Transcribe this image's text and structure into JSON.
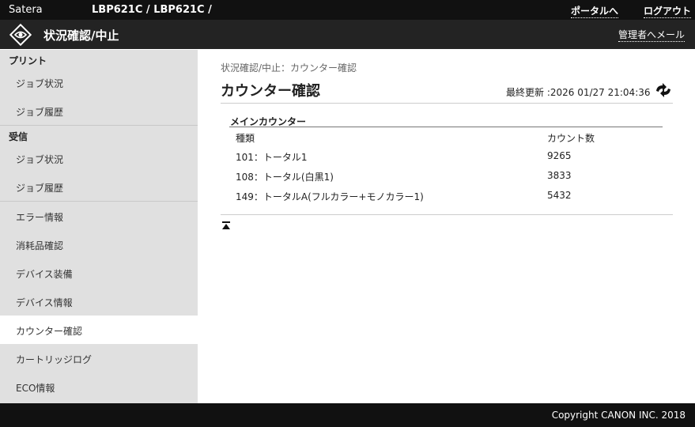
{
  "topbar": {
    "brand": "Satera",
    "model": "LBP621C / LBP621C /",
    "portal": "ポータルへ",
    "logout": "ログアウト"
  },
  "header": {
    "title": "状況確認/中止",
    "mail": "管理者へメール"
  },
  "sidebar": {
    "sections": [
      {
        "label": "プリント",
        "items": [
          "ジョブ状況",
          "ジョブ履歴"
        ]
      },
      {
        "label": "受信",
        "items": [
          "ジョブ状況",
          "ジョブ履歴"
        ]
      }
    ],
    "items": [
      "エラー情報",
      "消耗品確認",
      "デバイス装備",
      "デバイス情報",
      "カウンター確認",
      "カートリッジログ",
      "ECO情報"
    ],
    "selected": "カウンター確認"
  },
  "main": {
    "breadcrumb": "状況確認/中止：カウンター確認",
    "title": "カウンター確認",
    "last_updated": "最終更新 :2026 01/27 21:04:36",
    "section": "メインカウンター",
    "col_type": "種類",
    "col_count": "カウント数",
    "rows": [
      {
        "type": "101：トータル1",
        "count": "9265"
      },
      {
        "type": "108：トータル(白黒1)",
        "count": "3833"
      },
      {
        "type": "149：トータルA(フルカラー+モノカラー1)",
        "count": "5432"
      }
    ]
  },
  "footer": {
    "copyright": "Copyright CANON INC. 2018"
  }
}
